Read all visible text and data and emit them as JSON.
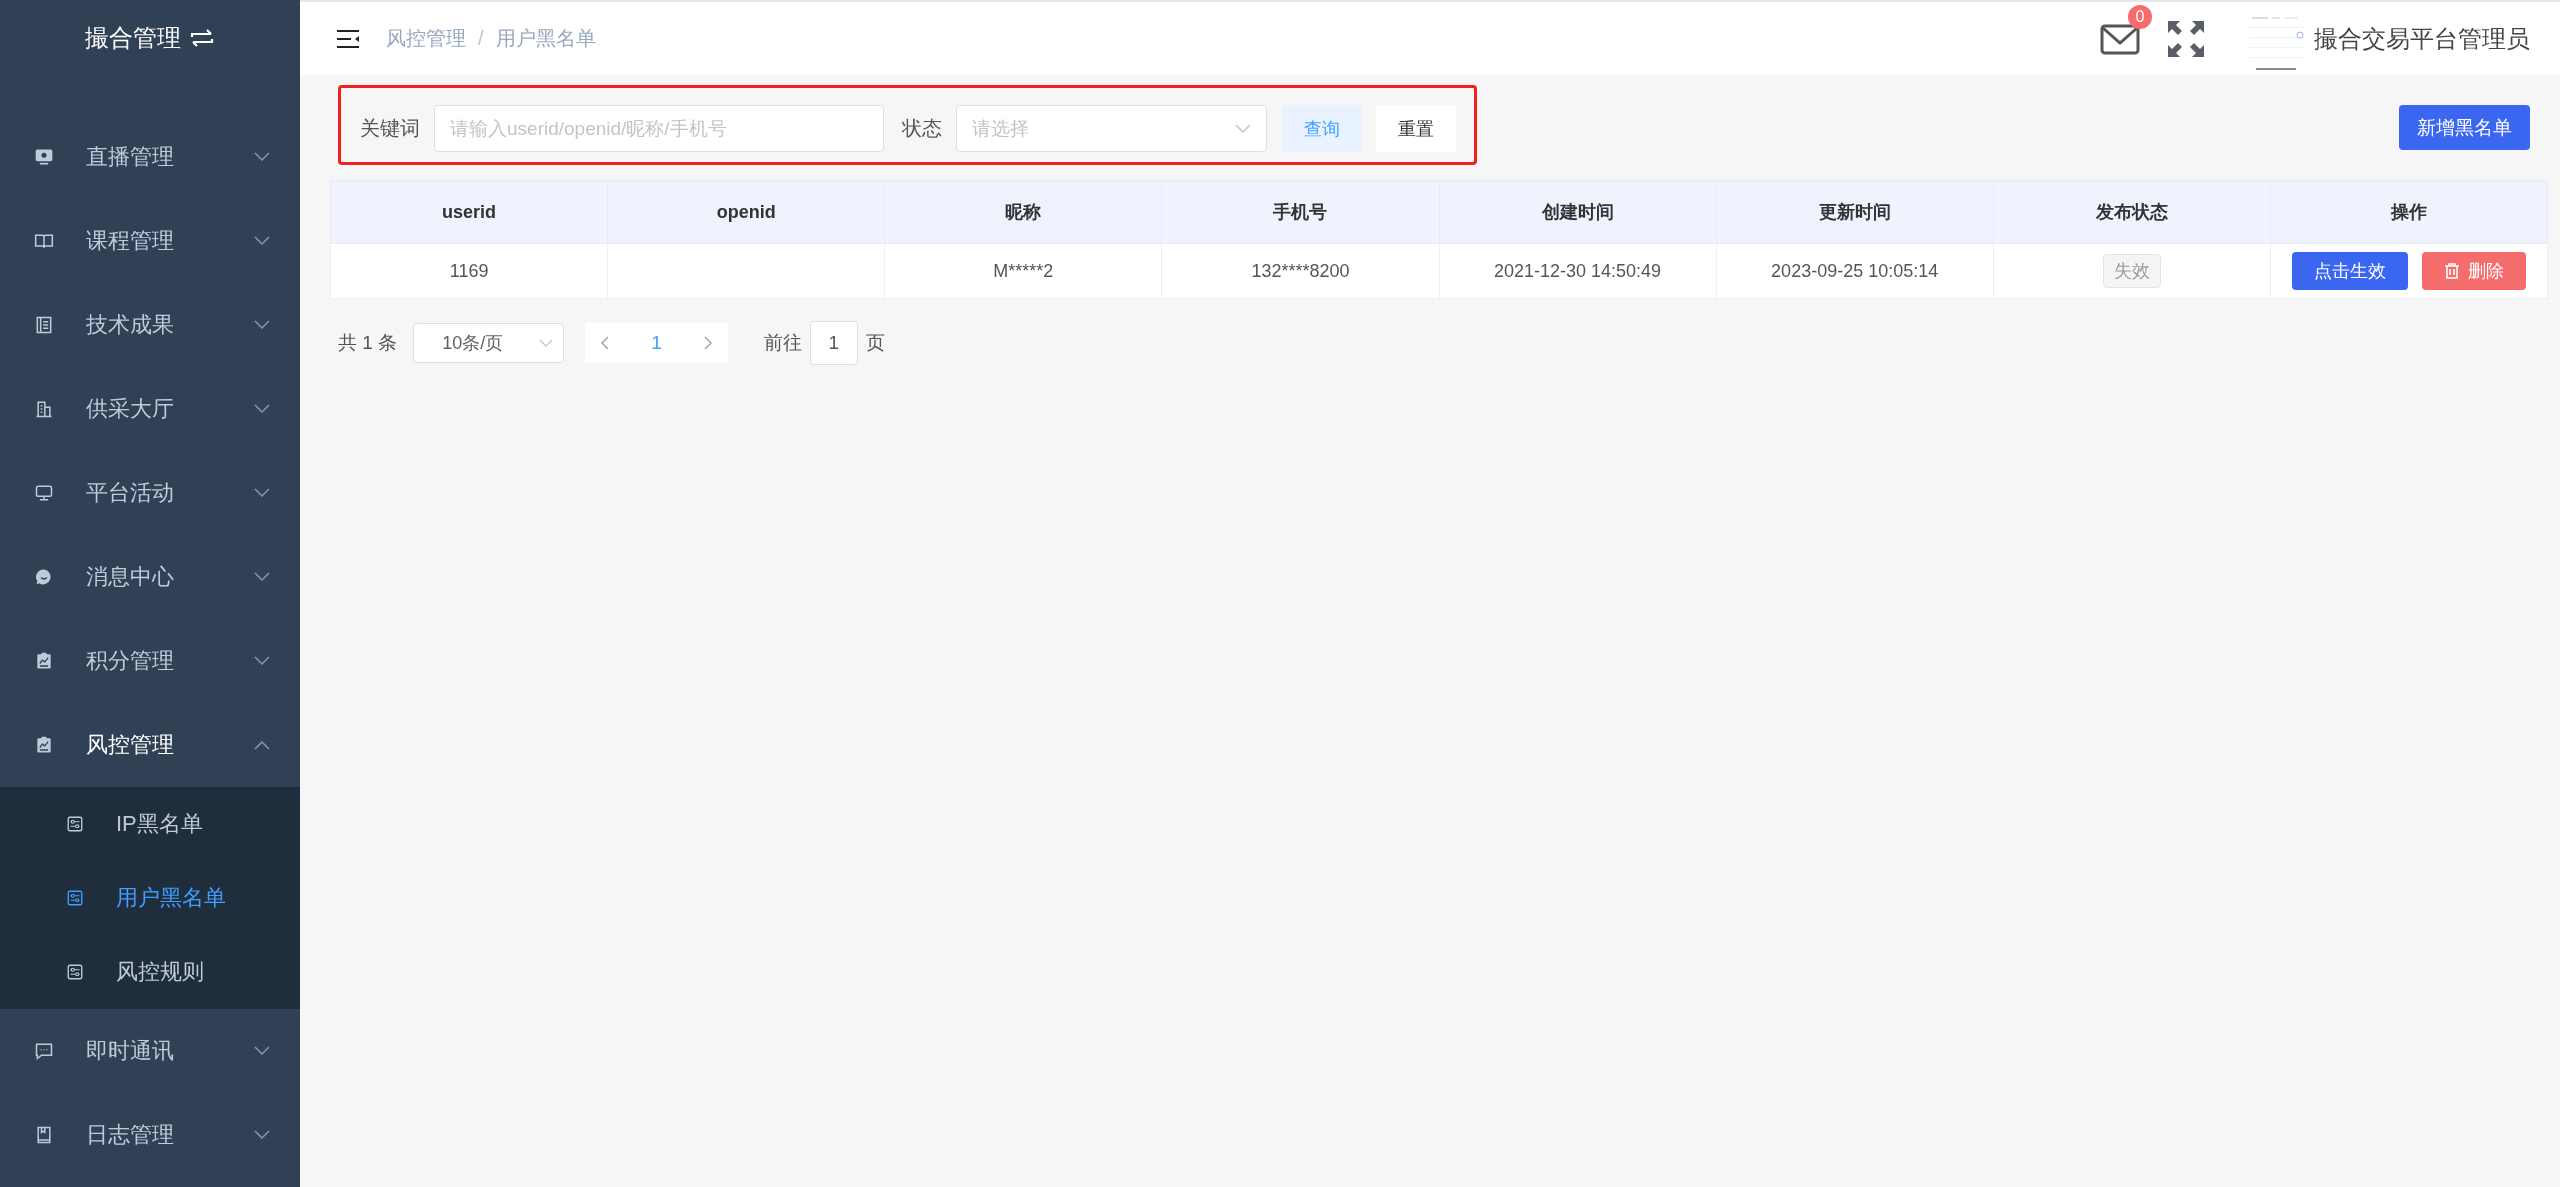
{
  "sidebar": {
    "title": "撮合管理",
    "items": [
      {
        "label": "直播管理",
        "expanded": false
      },
      {
        "label": "课程管理",
        "expanded": false
      },
      {
        "label": "技术成果",
        "expanded": false
      },
      {
        "label": "供采大厅",
        "expanded": false
      },
      {
        "label": "平台活动",
        "expanded": false
      },
      {
        "label": "消息中心",
        "expanded": false
      },
      {
        "label": "积分管理",
        "expanded": false
      },
      {
        "label": "风控管理",
        "expanded": true,
        "children": [
          {
            "label": "IP黑名单",
            "selected": false
          },
          {
            "label": "用户黑名单",
            "selected": true
          },
          {
            "label": "风控规则",
            "selected": false
          }
        ]
      },
      {
        "label": "即时通讯",
        "expanded": false
      },
      {
        "label": "日志管理",
        "expanded": false
      }
    ]
  },
  "header": {
    "breadcrumb": [
      "风控管理",
      "用户黑名单"
    ],
    "separator": "/",
    "mail_badge": "0",
    "user_name": "撮合交易平台管理员"
  },
  "filter": {
    "keyword_label": "关键词",
    "keyword_placeholder": "请输入userid/openid/昵称/手机号",
    "status_label": "状态",
    "status_placeholder": "请选择",
    "search_button": "查询",
    "reset_button": "重置"
  },
  "add_button": "新增黑名单",
  "table": {
    "columns": [
      "userid",
      "openid",
      "昵称",
      "手机号",
      "创建时间",
      "更新时间",
      "发布状态",
      "操作"
    ],
    "rows": [
      {
        "userid": "1169",
        "nickname": "M*****2",
        "phone": "132****8200",
        "created": "2021-12-30 14:50:49",
        "updated": "2023-09-25 10:05:14",
        "status": "失效",
        "actions": [
          {
            "label": "点击生效",
            "kind": "primary"
          },
          {
            "label": "删除",
            "kind": "danger"
          }
        ]
      }
    ]
  },
  "pagination": {
    "total": "共 1 条",
    "page_size": "10条/页",
    "pages": [
      {
        "label": "1",
        "selected": true
      }
    ],
    "goto_label": "前往",
    "goto_value": "1",
    "goto_unit": "页"
  }
}
